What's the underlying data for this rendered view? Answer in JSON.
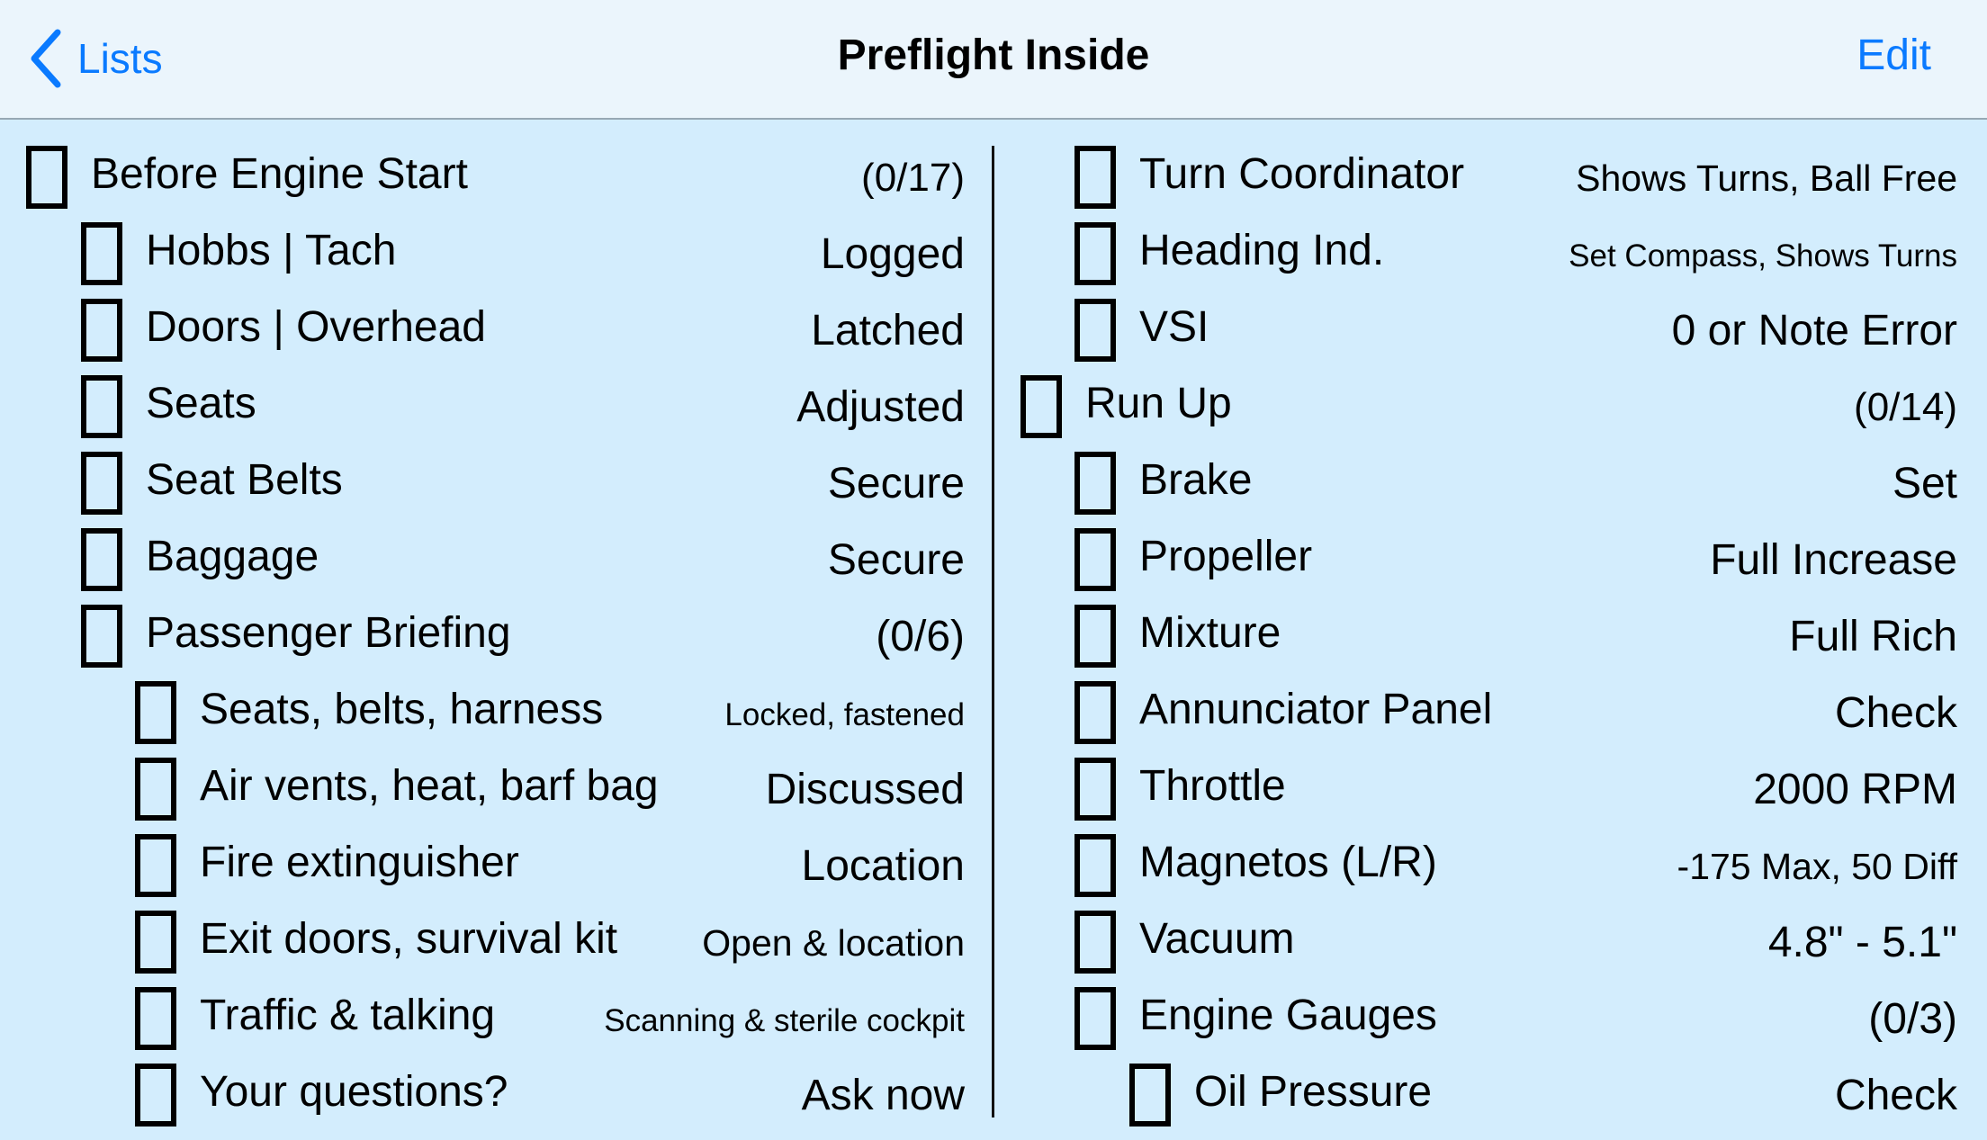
{
  "navbar": {
    "back_label": "Lists",
    "title": "Preflight Inside",
    "edit_label": "Edit",
    "accent_color": "#0a7aff"
  },
  "left_column": [
    {
      "level": 0,
      "label": "Before Engine Start",
      "value": "(0/17)",
      "style": "count",
      "checked": false
    },
    {
      "level": 1,
      "label": "Hobbs | Tach",
      "value": "Logged",
      "style": "normal",
      "checked": false
    },
    {
      "level": 1,
      "label": "Doors | Overhead",
      "value": "Latched",
      "style": "normal",
      "checked": false
    },
    {
      "level": 1,
      "label": "Seats",
      "value": "Adjusted",
      "style": "normal",
      "checked": false
    },
    {
      "level": 1,
      "label": "Seat Belts",
      "value": "Secure",
      "style": "normal",
      "checked": false
    },
    {
      "level": 1,
      "label": "Baggage",
      "value": "Secure",
      "style": "normal",
      "checked": false
    },
    {
      "level": 1,
      "label": "Passenger Briefing",
      "value": "(0/6)",
      "style": "normal",
      "checked": false
    },
    {
      "level": 2,
      "label": "Seats, belts, harness",
      "value": "Locked, fastened",
      "style": "small",
      "checked": false
    },
    {
      "level": 2,
      "label": "Air vents, heat, barf bag",
      "value": "Discussed",
      "style": "normal",
      "checked": false
    },
    {
      "level": 2,
      "label": "Fire extinguisher",
      "value": "Location",
      "style": "normal",
      "checked": false
    },
    {
      "level": 2,
      "label": "Exit doors, survival kit",
      "value": "Open & location",
      "style": "medium",
      "checked": false
    },
    {
      "level": 2,
      "label": "Traffic & talking",
      "value": "Scanning & sterile cockpit",
      "style": "small",
      "checked": false
    },
    {
      "level": 2,
      "label": "Your questions?",
      "value": "Ask now",
      "style": "normal",
      "checked": false
    }
  ],
  "right_column": [
    {
      "level": 1,
      "label": "Turn Coordinator",
      "value": "Shows Turns, Ball Free",
      "style": "medium",
      "checked": false
    },
    {
      "level": 1,
      "label": "Heading Ind.",
      "value": "Set Compass, Shows Turns",
      "style": "small",
      "checked": false
    },
    {
      "level": 1,
      "label": "VSI",
      "value": "0 or Note Error",
      "style": "normal",
      "checked": false
    },
    {
      "level": 0,
      "label": "Run Up",
      "value": "(0/14)",
      "style": "count",
      "checked": false
    },
    {
      "level": 1,
      "label": "Brake",
      "value": "Set",
      "style": "normal",
      "checked": false
    },
    {
      "level": 1,
      "label": "Propeller",
      "value": "Full Increase",
      "style": "normal",
      "checked": false
    },
    {
      "level": 1,
      "label": "Mixture",
      "value": "Full Rich",
      "style": "normal",
      "checked": false
    },
    {
      "level": 1,
      "label": "Annunciator Panel",
      "value": "Check",
      "style": "normal",
      "checked": false
    },
    {
      "level": 1,
      "label": "Throttle",
      "value": "2000 RPM",
      "style": "normal",
      "checked": false
    },
    {
      "level": 1,
      "label": "Magnetos (L/R)",
      "value": "-175 Max, 50 Diff",
      "style": "medium",
      "checked": false
    },
    {
      "level": 1,
      "label": "Vacuum",
      "value": "4.8\" - 5.1\"",
      "style": "normal",
      "checked": false
    },
    {
      "level": 1,
      "label": "Engine Gauges",
      "value": "(0/3)",
      "style": "normal",
      "checked": false
    },
    {
      "level": 2,
      "label": "Oil Pressure",
      "value": "Check",
      "style": "normal",
      "checked": false
    }
  ]
}
